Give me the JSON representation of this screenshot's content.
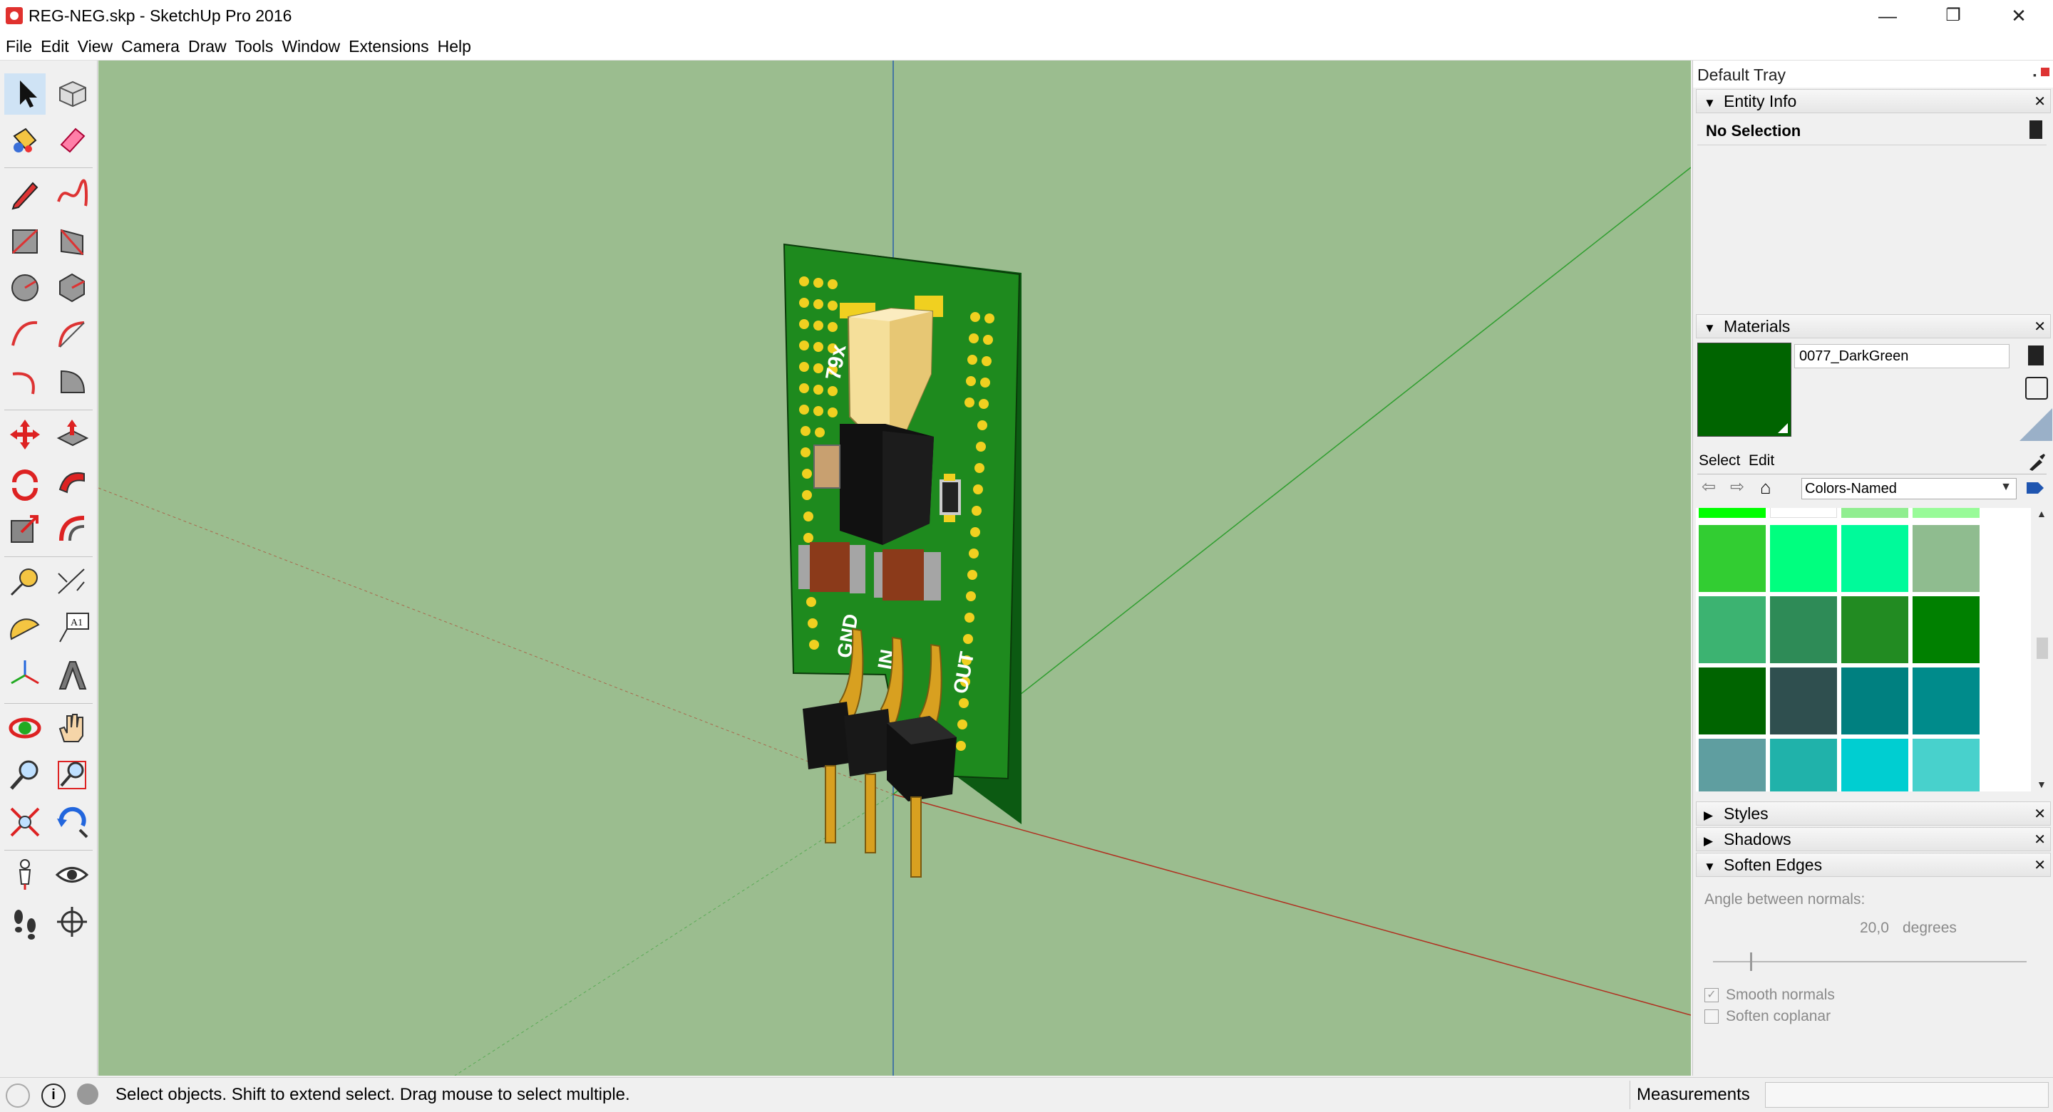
{
  "window": {
    "title": "REG-NEG.skp - SketchUp Pro 2016",
    "minimize_glyph": "—",
    "restore_glyph": "❐",
    "close_glyph": "✕"
  },
  "menu": [
    "File",
    "Edit",
    "View",
    "Camera",
    "Draw",
    "Tools",
    "Window",
    "Extensions",
    "Help"
  ],
  "toolbar_tools": [
    "select",
    "component",
    "paint-bucket",
    "eraser",
    "pencil",
    "freehand",
    "rectangle",
    "rotated-rectangle",
    "circle",
    "polygon",
    "arc",
    "two-point-arc",
    "three-point-arc",
    "pie",
    "move",
    "push-pull",
    "rotate",
    "follow-me",
    "scale",
    "offset",
    "tape-measure",
    "dimension",
    "protractor",
    "text",
    "axes",
    "3d-text",
    "orbit",
    "pan",
    "zoom",
    "zoom-window",
    "zoom-extents",
    "previous",
    "position-camera",
    "look-around",
    "walk",
    "section-plane"
  ],
  "tray": {
    "title": "Default Tray",
    "entity_info": {
      "label": "Entity Info",
      "selection": "No Selection"
    },
    "materials": {
      "label": "Materials",
      "current_material": "0077_DarkGreen",
      "current_color": "#006400",
      "select_tab": "Select",
      "edit_tab": "Edit",
      "library": "Colors-Named",
      "swatches": [
        [
          "#00ff00",
          "#ffffff",
          "#90ee90",
          "#98fb98"
        ],
        [
          "#32cd32",
          "#00ff7f",
          "#00fa9a",
          "#8fbc8f"
        ],
        [
          "#3cb371",
          "#2e8b57",
          "#228b22",
          "#008000"
        ],
        [
          "#006400",
          "#2f4f4f",
          "#008080",
          "#008b8b"
        ],
        [
          "#5f9ea0",
          "#20b2aa",
          "#00ced1",
          "#48d1cc"
        ]
      ]
    },
    "styles_label": "Styles",
    "shadows_label": "Shadows",
    "soften_edges": {
      "label": "Soften Edges",
      "angle_label": "Angle between normals:",
      "angle_value": "20,0",
      "angle_unit": "degrees",
      "smooth_normals": "Smooth normals",
      "soften_coplanar": "Soften coplanar"
    }
  },
  "status": {
    "hint": "Select objects. Shift to extend select. Drag mouse to select multiple.",
    "measurements_label": "Measurements"
  },
  "model": {
    "silkscreen": [
      "79x",
      "GND",
      "IN",
      "OUT"
    ]
  }
}
